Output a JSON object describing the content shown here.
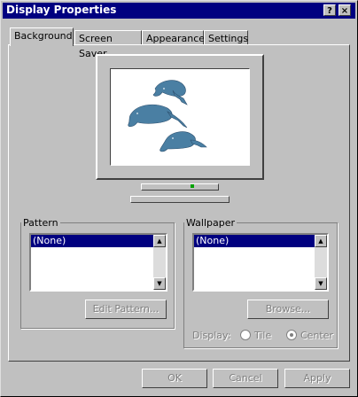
{
  "window": {
    "title": "Display Properties",
    "help_label": "?",
    "close_label": "×"
  },
  "tabs": [
    {
      "label": "Background"
    },
    {
      "label": "Screen Saver"
    },
    {
      "label": "Appearance"
    },
    {
      "label": "Settings"
    }
  ],
  "pattern": {
    "legend": "Pattern",
    "selected": "(None)",
    "edit_button": "Edit Pattern..."
  },
  "wallpaper": {
    "legend": "Wallpaper",
    "selected": "(None)",
    "browse_button": "Browse...",
    "display_label": "Display:",
    "tile_label": "Tile",
    "center_label": "Center",
    "display_mode": "center"
  },
  "buttons": {
    "ok": "OK",
    "cancel": "Cancel",
    "apply": "Apply"
  },
  "colors": {
    "titlebar": "#000080",
    "face": "#c0c0c0",
    "selection": "#000080"
  }
}
